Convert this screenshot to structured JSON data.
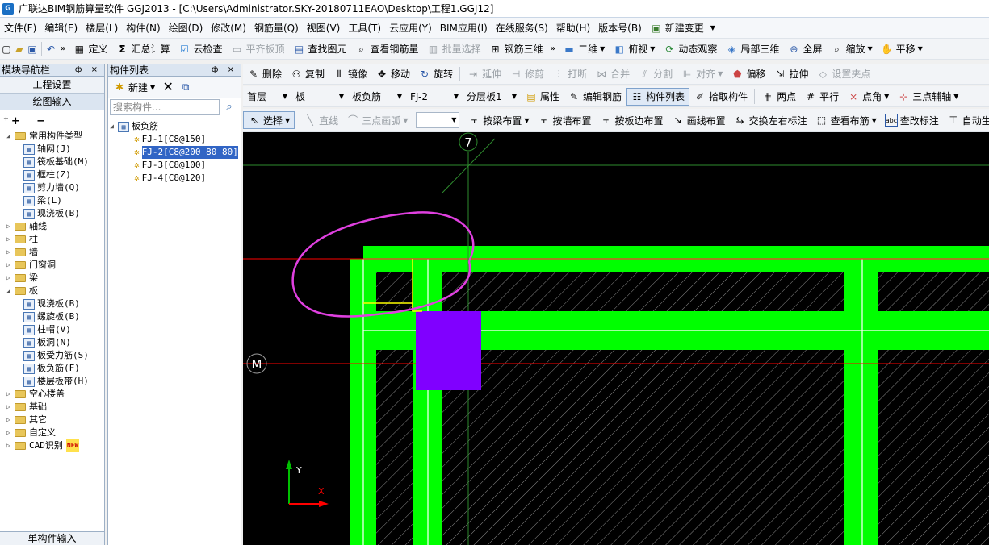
{
  "title": "广联达BIM钢筋算量软件 GGJ2013 - [C:\\Users\\Administrator.SKY-20180711EAO\\Desktop\\工程1.GGJ12]",
  "menu": [
    "文件(F)",
    "编辑(E)",
    "楼层(L)",
    "构件(N)",
    "绘图(D)",
    "修改(M)",
    "钢筋量(Q)",
    "视图(V)",
    "工具(T)",
    "云应用(Y)",
    "BIM应用(I)",
    "在线服务(S)",
    "帮助(H)",
    "版本号(B)",
    "新建变更"
  ],
  "toolbar1": {
    "define": "定义",
    "sum": "汇总计算",
    "cloud_check": "云检查",
    "flush_slab": "平齐板顶",
    "find": "查找图元",
    "view_rebar": "查看钢筋量",
    "batch_select": "批量选择",
    "rebar_3d": "钢筋三维",
    "two_d": "二维",
    "top_view": "俯视",
    "dynamic": "动态观察",
    "local_3d": "局部三维",
    "fullscreen": "全屏",
    "zoom": "缩放",
    "pan": "平移"
  },
  "toolbar2": {
    "delete": "删除",
    "copy": "复制",
    "mirror": "镜像",
    "move": "移动",
    "rotate": "旋转",
    "extend": "延伸",
    "trim": "修剪",
    "break": "打断",
    "merge": "合并",
    "split": "分割",
    "align": "对齐",
    "offset": "偏移",
    "stretch": "拉伸",
    "set_point": "设置夹点"
  },
  "toolbar3": {
    "floor": "首层",
    "type": "板",
    "subtype": "板负筋",
    "component": "FJ-2",
    "layer": "分层板1",
    "props": "属性",
    "edit_rebar": "编辑钢筋",
    "comp_list": "构件列表",
    "pick": "拾取构件",
    "two_point": "两点",
    "parallel": "平行",
    "angle": "点角",
    "three_point": "三点辅轴"
  },
  "toolbar4": {
    "select": "选择",
    "line": "直线",
    "arc": "三点画弧",
    "by_beam": "按梁布置",
    "by_wall": "按墙布置",
    "by_slab_edge": "按板边布置",
    "draw_line": "画线布置",
    "swap": "交换左右标注",
    "view_rebar": "查看布筋",
    "check_label": "查改标注",
    "auto": "自动生"
  },
  "nav": {
    "header": "模块导航栏",
    "pin": "ф ×",
    "btn_settings": "工程设置",
    "btn_draw": "绘图输入",
    "bottom": "单构件输入",
    "tree": [
      {
        "label": "常用构件类型",
        "level": 0,
        "kind": "folder",
        "open": true
      },
      {
        "label": "轴网(J)",
        "level": 1,
        "kind": "leaf"
      },
      {
        "label": "筏板基础(M)",
        "level": 1,
        "kind": "leaf"
      },
      {
        "label": "框柱(Z)",
        "level": 1,
        "kind": "leaf"
      },
      {
        "label": "剪力墙(Q)",
        "level": 1,
        "kind": "leaf"
      },
      {
        "label": "梁(L)",
        "level": 1,
        "kind": "leaf"
      },
      {
        "label": "现浇板(B)",
        "level": 1,
        "kind": "leaf"
      },
      {
        "label": "轴线",
        "level": 0,
        "kind": "folder"
      },
      {
        "label": "柱",
        "level": 0,
        "kind": "folder"
      },
      {
        "label": "墙",
        "level": 0,
        "kind": "folder"
      },
      {
        "label": "门窗洞",
        "level": 0,
        "kind": "folder"
      },
      {
        "label": "梁",
        "level": 0,
        "kind": "folder"
      },
      {
        "label": "板",
        "level": 0,
        "kind": "folder",
        "open": true
      },
      {
        "label": "现浇板(B)",
        "level": 1,
        "kind": "leaf"
      },
      {
        "label": "螺旋板(B)",
        "level": 1,
        "kind": "leaf"
      },
      {
        "label": "柱帽(V)",
        "level": 1,
        "kind": "leaf"
      },
      {
        "label": "板洞(N)",
        "level": 1,
        "kind": "leaf"
      },
      {
        "label": "板受力筋(S)",
        "level": 1,
        "kind": "leaf"
      },
      {
        "label": "板负筋(F)",
        "level": 1,
        "kind": "leaf"
      },
      {
        "label": "楼层板带(H)",
        "level": 1,
        "kind": "leaf"
      },
      {
        "label": "空心楼盖",
        "level": 0,
        "kind": "folder"
      },
      {
        "label": "基础",
        "level": 0,
        "kind": "folder"
      },
      {
        "label": "其它",
        "level": 0,
        "kind": "folder"
      },
      {
        "label": "自定义",
        "level": 0,
        "kind": "folder"
      },
      {
        "label": "CAD识别",
        "level": 0,
        "kind": "folder",
        "badge": "NEW"
      }
    ]
  },
  "comp_list": {
    "header": "构件列表",
    "pin": "ф ×",
    "new_label": "新建",
    "search_placeholder": "搜索构件...",
    "root": "板负筋",
    "items": [
      "FJ-1[C8@150]",
      "FJ-2[C8@200 80 80]",
      "FJ-3[C8@100]",
      "FJ-4[C8@120]"
    ],
    "selected_index": 1
  },
  "canvas": {
    "axis_top": "7",
    "axis_left": "M",
    "ucs_x": "X",
    "ucs_y": "Y"
  },
  "colors": {
    "canvas_bg": "#000000",
    "beam": "#00ff00",
    "column": "#8000ff",
    "axis_line": "#ff0000",
    "annotation": "#e040e0"
  }
}
